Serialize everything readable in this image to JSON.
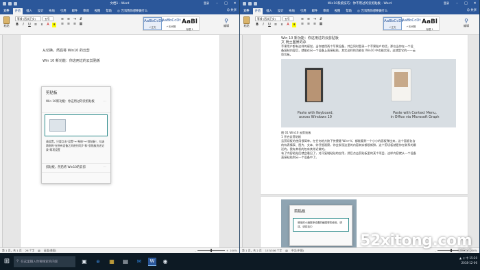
{
  "left_window": {
    "title": "文档1 - Word",
    "signin": "登录 ",
    "share": "共享",
    "tabs": [
      "文件",
      "开始",
      "插入",
      "设计",
      "布局",
      "引用",
      "邮件",
      "审阅",
      "视图",
      "帮助"
    ],
    "tell_me": "告诉我你想要做什么",
    "paste": "粘贴",
    "font_name": "等线 (西文正文)",
    "font_size": "五号",
    "styles": [
      {
        "sample": "AaBbCcDt",
        "name": "↵正文"
      },
      {
        "sample": "AaBbCcDt",
        "name": "↵无间隔"
      },
      {
        "sample": "AaBl",
        "name": "标题 1"
      }
    ],
    "editing": "编辑",
    "doc_lines": [
      "从切换，然后将 Win10 的云剪",
      "Win 10 新功能：你这用过的云剪贴板"
    ],
    "clipboard_panel": {
      "title": "剪贴板",
      "items": [
        "Win 10新功能：你这用过的云剪贴板",
        "",
        "请设置，只要点击\"设置\"→\"系统\"→\"剪贴板\"，勾选两侧的\"在所有设备之间进行同步\"和\"剪贴板历史记录\"两项设置",
        "剪贴板，然后将 Win10的云剪"
      ]
    },
    "status": {
      "page": "第 1 页，共 1 页",
      "words": "26 个字",
      "lang": "英语(美国)",
      "zoom": "100%"
    }
  },
  "right_window": {
    "title": "Win10系统技巧：你不用过的云剪贴板 - Word",
    "signin": "登录",
    "share": "共享",
    "tabs": [
      "文件",
      "开始",
      "插入",
      "设计",
      "布局",
      "引用",
      "邮件",
      "审阅",
      "视图",
      "帮助"
    ],
    "tell_me": "告诉我你想要做什么",
    "paste": "粘贴",
    "font_name": "等线 (西文正文)",
    "font_size": "五号",
    "styles": [
      {
        "sample": "AaBbCcDt",
        "name": "↵正文"
      },
      {
        "sample": "AaBbCcDt",
        "name": "↵无间隔"
      },
      {
        "sample": "AaBl",
        "name": "标题 1"
      }
    ],
    "editing": "编辑",
    "doc_lines": [
      "Win 10 新功能：你这用过的云剪贴板",
      "文  杨土图景的杀",
      "苹果用户都有这样的感觉，当你使用两个苹果设备，并且同时登录一个苹果账户的话，那在当你在一个设",
      "备复制内容后，就能在另一个设备上直接粘贴，其实这样的功能在 Win10 中也能实现，这就是它的——云",
      "剪切板。"
    ],
    "figure_captions": [
      "Paste with Keyboard,",
      "across Windows 10",
      "Paste with Context Menu,",
      "in Office via Microsoft Graph"
    ],
    "doc_lines_2": [
      "图 01 Win10 云剪贴板",
      "1  开启云剪贴板",
      "云剪切板的使用很简单，在任何地方按下快捷键 Win+V，都能看到一个小小的面板弹出来，这个面板包含",
      "的有表情表、图片、文本、你仔细观察，你会发现这里的内容其实都很新鲜，这个剪切板就是你在联系的最",
      "近的，我有其机的包有其你近做的。",
      "有了内容粘贴后就会看见了，对开复制粘贴的应用，然后点击剪贴板里的某个项目，这样内容就从一个设备",
      "直接粘贴到另一个设备中了。"
    ],
    "clipboard_panel_2": {
      "title": "剪贴板",
      "items": [
        "微信的小编推荐设置的截图哪些使用，请将，请将选中"
      ]
    },
    "status": {
      "page": "第 1 页，共 2 页",
      "words": "157/306 个字",
      "lang": "中文(中国)",
      "zoom": "100%"
    }
  },
  "taskbar": {
    "search_placeholder": "在这里输入你要搜索的内容",
    "tray_time": "15:20",
    "tray_date": "2018-12-06",
    "tray_lang": "中"
  },
  "watermark": {
    "main": "52xitong.com",
    "sub": "系统之家"
  },
  "colors": {
    "word_blue": "#2b579a",
    "taskbar": "#0d1a24"
  }
}
